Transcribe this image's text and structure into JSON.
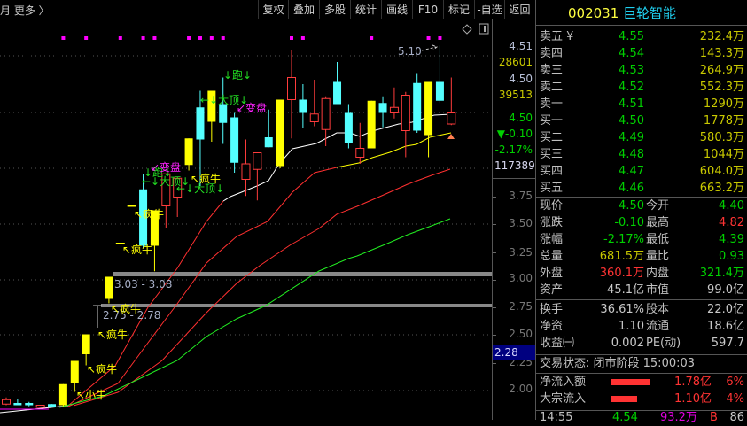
{
  "toolbar": {
    "more_label": "月 更多 〉",
    "buttons": [
      "复权",
      "叠加",
      "多股",
      "统计",
      "画线",
      "F10",
      "标记",
      "-自选",
      "返回"
    ]
  },
  "chart": {
    "high_label": "5.10",
    "gap_zones": [
      {
        "label": "3.03 - 3.08",
        "low": 3.03,
        "high": 3.08
      },
      {
        "label": "2.75 - 2.78",
        "low": 2.75,
        "high": 2.78
      }
    ],
    "candles": [
      {
        "o": 1.87,
        "c": 1.91,
        "h": 1.93,
        "l": 1.86,
        "k": "up"
      },
      {
        "o": 1.88,
        "c": 1.86,
        "h": 1.92,
        "l": 1.86,
        "k": "down"
      },
      {
        "o": 1.88,
        "c": 1.86,
        "h": 1.89,
        "l": 1.85,
        "k": "down"
      },
      {
        "o": 1.84,
        "c": 1.86,
        "h": 1.86,
        "l": 1.84,
        "k": "up"
      },
      {
        "o": 1.87,
        "c": 1.84,
        "h": 1.87,
        "l": 1.84,
        "k": "down"
      },
      {
        "o": 1.86,
        "c": 2.05,
        "h": 2.05,
        "l": 1.85,
        "k": "limit"
      },
      {
        "o": 2.06,
        "c": 2.26,
        "h": 2.26,
        "l": 1.98,
        "k": "limit"
      },
      {
        "o": 2.32,
        "c": 2.5,
        "h": 2.5,
        "l": 2.22,
        "k": "limit"
      },
      {
        "o": 2.76,
        "c": 2.76,
        "h": 2.76,
        "l": 2.56,
        "k": "doji"
      },
      {
        "o": 2.82,
        "c": 3.02,
        "h": 3.02,
        "l": 2.78,
        "k": "limit"
      },
      {
        "o": 3.32,
        "c": 3.32,
        "h": 3.32,
        "l": 3.32,
        "k": "flat"
      },
      {
        "o": 3.66,
        "c": 3.66,
        "h": 3.66,
        "l": 3.66,
        "k": "flat"
      },
      {
        "o": 3.81,
        "c": 3.3,
        "h": 3.95,
        "l": 3.28,
        "k": "down"
      },
      {
        "o": 3.3,
        "c": 3.62,
        "h": 3.62,
        "l": 3.07,
        "k": "limit"
      },
      {
        "o": 3.66,
        "c": 3.95,
        "h": 3.95,
        "l": 3.46,
        "k": "up"
      },
      {
        "o": 3.74,
        "c": 3.91,
        "h": 3.91,
        "l": 3.56,
        "k": "up"
      },
      {
        "o": 4.03,
        "c": 4.27,
        "h": 4.27,
        "l": 3.98,
        "k": "limit"
      },
      {
        "o": 4.55,
        "c": 4.26,
        "h": 4.7,
        "l": 3.84,
        "k": "down"
      },
      {
        "o": 4.42,
        "c": 4.7,
        "h": 4.7,
        "l": 4.24,
        "k": "limit"
      },
      {
        "o": 4.58,
        "c": 4.41,
        "h": 4.82,
        "l": 4.22,
        "k": "down"
      },
      {
        "o": 4.46,
        "c": 4.05,
        "h": 4.5,
        "l": 3.96,
        "k": "down"
      },
      {
        "o": 3.9,
        "c": 4.04,
        "h": 4.26,
        "l": 3.75,
        "k": "up"
      },
      {
        "o": 3.99,
        "c": 4.14,
        "h": 4.14,
        "l": 3.71,
        "k": "up"
      },
      {
        "o": 4.28,
        "c": 4.19,
        "h": 4.53,
        "l": 4.19,
        "k": "down"
      },
      {
        "o": 4.02,
        "c": 4.62,
        "h": 4.62,
        "l": 4.0,
        "k": "limit"
      },
      {
        "o": 4.62,
        "c": 4.82,
        "h": 5.07,
        "l": 4.27,
        "k": "up"
      },
      {
        "o": 4.62,
        "c": 4.5,
        "h": 4.76,
        "l": 4.36,
        "k": "down"
      },
      {
        "o": 4.42,
        "c": 4.49,
        "h": 4.8,
        "l": 4.38,
        "k": "up"
      },
      {
        "o": 4.35,
        "c": 4.63,
        "h": 4.65,
        "l": 4.2,
        "k": "up"
      },
      {
        "o": 4.78,
        "c": 4.58,
        "h": 4.96,
        "l": 4.58,
        "k": "down"
      },
      {
        "o": 4.5,
        "c": 4.23,
        "h": 4.58,
        "l": 4.18,
        "k": "down"
      },
      {
        "o": 4.1,
        "c": 4.18,
        "h": 4.41,
        "l": 4.04,
        "k": "up"
      },
      {
        "o": 4.18,
        "c": 4.61,
        "h": 4.61,
        "l": 4.18,
        "k": "limit"
      },
      {
        "o": 4.59,
        "c": 4.5,
        "h": 4.65,
        "l": 4.37,
        "k": "down"
      },
      {
        "o": 4.5,
        "c": 4.55,
        "h": 4.73,
        "l": 4.45,
        "k": "up"
      },
      {
        "o": 4.34,
        "c": 4.66,
        "h": 4.69,
        "l": 4.1,
        "k": "up"
      },
      {
        "o": 4.77,
        "c": 4.34,
        "h": 4.86,
        "l": 4.32,
        "k": "down"
      },
      {
        "o": 4.3,
        "c": 4.78,
        "h": 4.78,
        "l": 4.1,
        "k": "limit"
      },
      {
        "o": 4.78,
        "c": 4.61,
        "h": 5.11,
        "l": 4.59,
        "k": "down"
      },
      {
        "o": 4.4,
        "c": 4.5,
        "h": 4.82,
        "l": 4.39,
        "k": "up"
      }
    ],
    "signal_dot_candles": [
      5,
      7,
      10,
      12,
      13,
      16,
      17,
      18,
      19,
      25,
      26,
      32,
      37,
      38
    ],
    "annotations": [
      "↖小牛",
      "↖疯牛",
      "↖疯牛",
      "↖疯牛",
      "↖疯牛",
      "↖疯牛",
      "↖疯牛",
      "↓跑↓",
      "↙变盘",
      "←↓大顶↓",
      "←↓大顶↓",
      "↓跑↓",
      "←↓大顶↓",
      "↙变盘"
    ],
    "colors": {
      "up": "#ff3c3c",
      "down": "#54ffff",
      "limit": "#ffff00",
      "doji": "#c0c0c0",
      "flat": "#ffff00",
      "signal": "#ff00ff"
    }
  },
  "axis": {
    "readouts": [
      "4.51",
      "28601",
      "4.50",
      "39513",
      "4.50",
      "▼-0.10",
      "-2.17%",
      "117389"
    ],
    "ticks": [
      "3.75",
      "3.50",
      "3.25",
      "3.00",
      "2.75",
      "2.50",
      "2.25",
      "2.00"
    ],
    "cursor_price": "2.28"
  },
  "quote": {
    "code": "002031",
    "name": "巨轮智能",
    "asks": [
      {
        "label": "卖五 ¥",
        "price": "4.55",
        "vol": "232.4万"
      },
      {
        "label": "卖四",
        "price": "4.54",
        "vol": "143.3万"
      },
      {
        "label": "卖三",
        "price": "4.53",
        "vol": "264.9万"
      },
      {
        "label": "卖二",
        "price": "4.52",
        "vol": "552.3万"
      },
      {
        "label": "卖一",
        "price": "4.51",
        "vol": "1290万"
      }
    ],
    "bids": [
      {
        "label": "买一",
        "price": "4.50",
        "vol": "1778万"
      },
      {
        "label": "买二",
        "price": "4.49",
        "vol": "580.3万"
      },
      {
        "label": "买三",
        "price": "4.48",
        "vol": "1044万"
      },
      {
        "label": "买四",
        "price": "4.47",
        "vol": "604.0万"
      },
      {
        "label": "买五",
        "price": "4.46",
        "vol": "663.2万"
      }
    ],
    "stats": [
      {
        "l1": "现价",
        "v1": "4.50",
        "l2": "今开",
        "v2": "4.40"
      },
      {
        "l1": "涨跌",
        "v1": "-0.10",
        "l2": "最高",
        "v2": "4.82"
      },
      {
        "l1": "涨幅",
        "v1": "-2.17%",
        "l2": "最低",
        "v2": "4.39"
      },
      {
        "l1": "总量",
        "v1": "681.5万",
        "l2": "量比",
        "v2": "0.93"
      },
      {
        "l1": "外盘",
        "v1": "360.1万",
        "l2": "内盘",
        "v2": "321.4万"
      },
      {
        "l1": "资产",
        "v1": "45.1亿",
        "l2": "市值",
        "v2": "99.0亿"
      }
    ],
    "stats2": [
      {
        "l1": "换手",
        "v1": "36.61%",
        "l2": "股本",
        "v2": "22.0亿"
      },
      {
        "l1": "净资",
        "v1": "1.10",
        "l2": "流通",
        "v2": "18.6亿"
      },
      {
        "l1": "收益㈠",
        "v1": "0.002",
        "l2": "PE(动)",
        "v2": "597.7"
      }
    ],
    "status": "交易状态: 闭市阶段 15:00:03",
    "flows": [
      {
        "label": "净流入额",
        "amount": "1.78亿",
        "pct": "6%",
        "pct_value": 6
      },
      {
        "label": "大宗流入",
        "amount": "1.10亿",
        "pct": "4%",
        "pct_value": 4
      }
    ],
    "tick": {
      "time": "14:55",
      "price": "4.54",
      "vol": "93.2万",
      "side": "B",
      "count": "86"
    }
  }
}
